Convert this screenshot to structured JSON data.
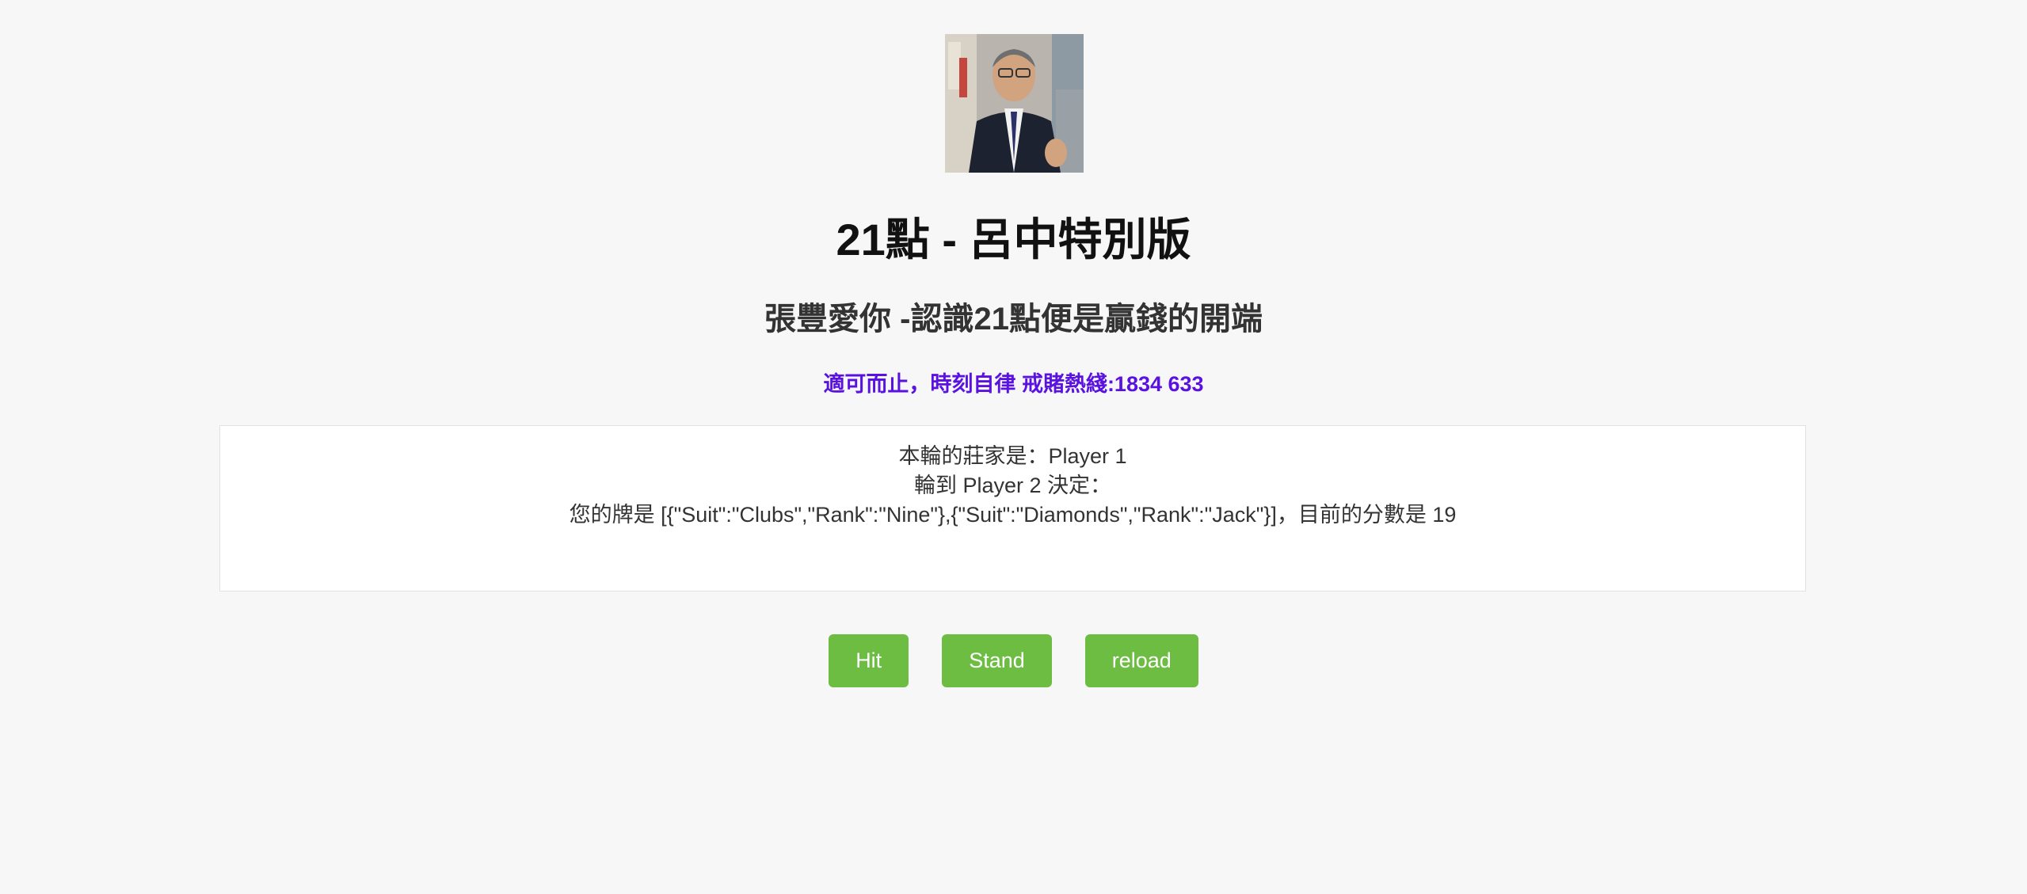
{
  "header": {
    "title": "21點 - 呂中特別版",
    "subtitle": "張豐愛你 -認識21點便是贏錢的開端",
    "warning": "適可而止，時刻自律 戒賭熱綫:1834 633"
  },
  "game": {
    "dealer_line": "本輪的莊家是：Player 1",
    "turn_line": "輪到 Player 2 決定：",
    "hand_line": "您的牌是 [{\"Suit\":\"Clubs\",\"Rank\":\"Nine\"},{\"Suit\":\"Diamonds\",\"Rank\":\"Jack\"}]，目前的分數是 19"
  },
  "controls": {
    "hit_label": "Hit",
    "stand_label": "Stand",
    "reload_label": "reload"
  },
  "colors": {
    "background": "#f7f7f7",
    "warning_text": "#5a12e0",
    "button_bg": "#6dbd43",
    "button_text": "#ffffff"
  }
}
